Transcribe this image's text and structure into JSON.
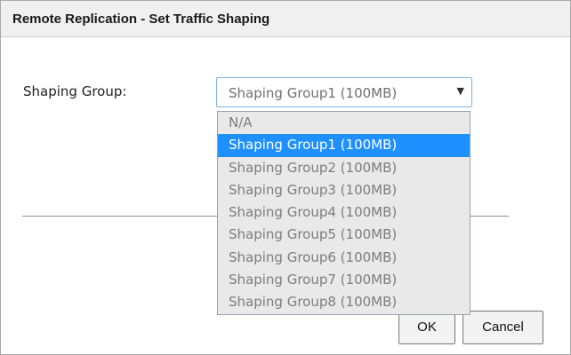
{
  "dialog": {
    "title": "Remote Replication - Set Traffic Shaping"
  },
  "form": {
    "shaping_group_label": "Shaping Group:",
    "shaping_group_value": "Shaping Group1 (100MB)",
    "caret_glyph": "▼",
    "dropdown_open": true,
    "selected_index": 1,
    "options": [
      "N/A",
      "Shaping Group1 (100MB)",
      "Shaping Group2 (100MB)",
      "Shaping Group3 (100MB)",
      "Shaping Group4 (100MB)",
      "Shaping Group5 (100MB)",
      "Shaping Group6 (100MB)",
      "Shaping Group7 (100MB)",
      "Shaping Group8 (100MB)"
    ]
  },
  "buttons": {
    "ok_label": "OK",
    "cancel_label": "Cancel"
  },
  "colors": {
    "highlight": "#1e90ff",
    "dropdown_bg": "#e9e9e9",
    "titlebar_bg": "#f0f0f0",
    "select_border": "#7fb0e6"
  }
}
